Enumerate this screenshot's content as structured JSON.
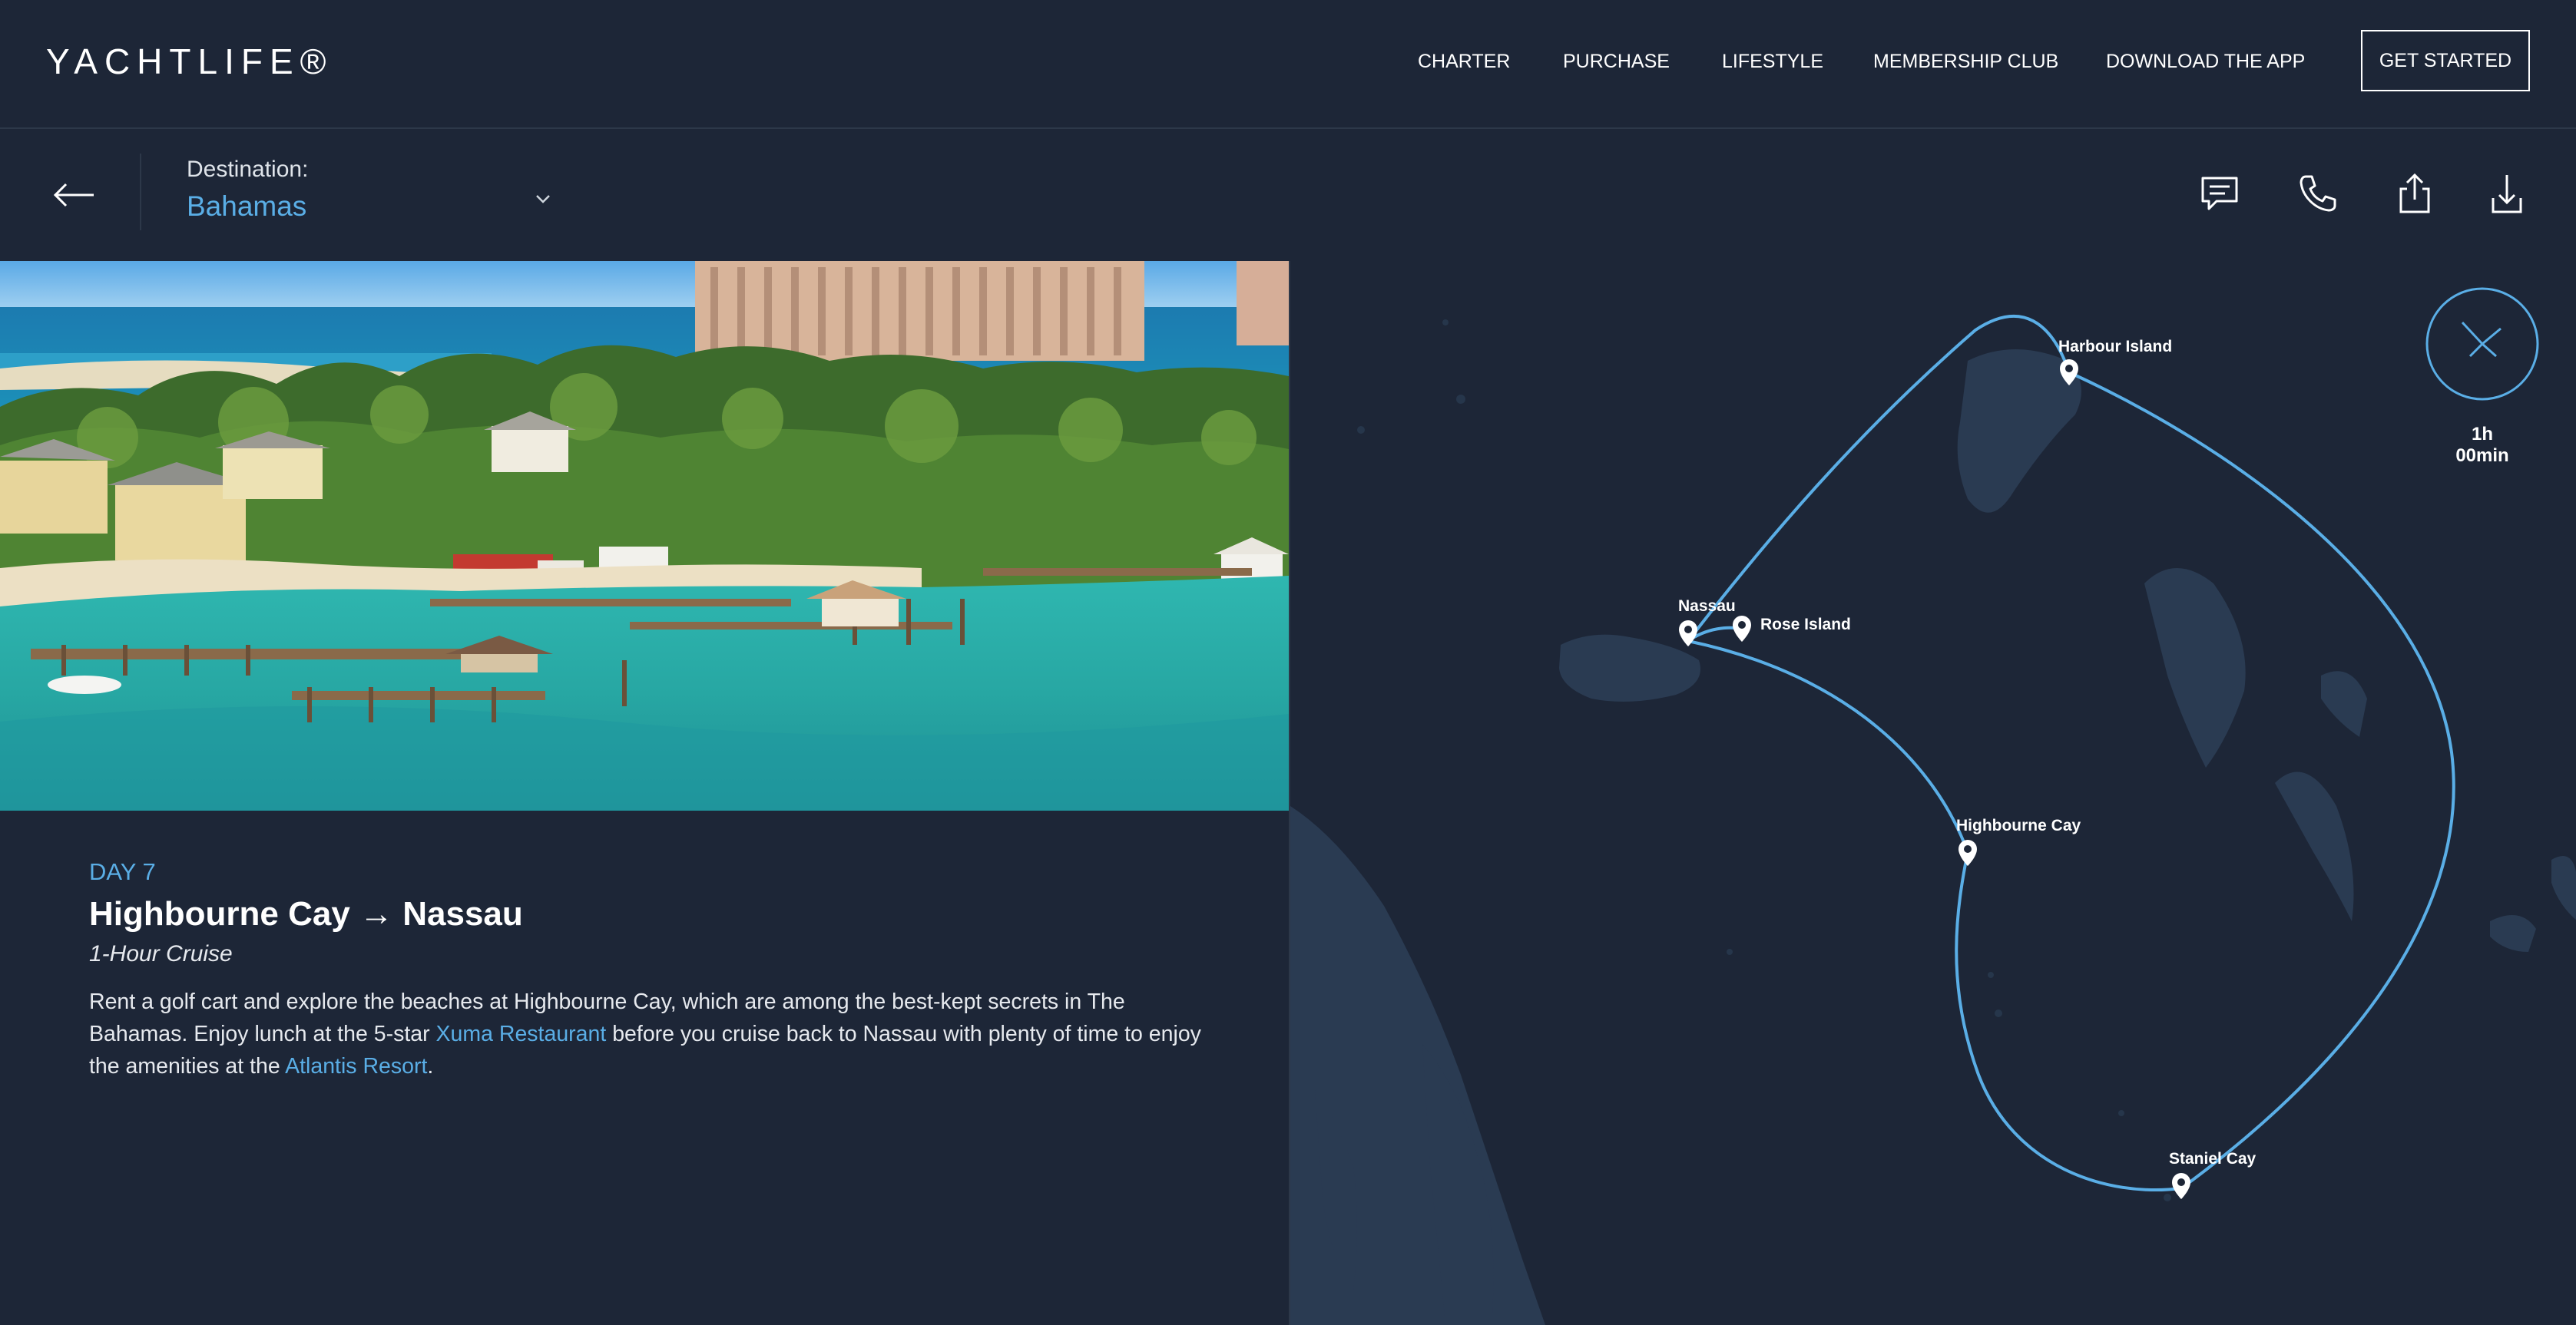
{
  "brand": {
    "logo": "YACHTLIFE®"
  },
  "nav": {
    "links": [
      "CHARTER",
      "PURCHASE",
      "LIFESTYLE",
      "MEMBERSHIP CLUB",
      "DOWNLOAD THE APP"
    ],
    "cta": "GET STARTED"
  },
  "destination": {
    "label": "Destination:",
    "value": "Bahamas",
    "icons": [
      "back-arrow-icon",
      "chevron-down-icon",
      "chat-icon",
      "phone-icon",
      "share-icon",
      "download-icon"
    ]
  },
  "itinerary": {
    "day": "DAY 7",
    "title": "Highbourne Cay → Nassau",
    "subtitle": "1-Hour Cruise",
    "desc_part1": "Rent a golf cart and explore the beaches at Highbourne Cay, which are among the best-kept secrets in The Bahamas. Enjoy lunch at the 5-star ",
    "link1": "Xuma Restaurant",
    "desc_part2": " before you cruise back to Nassau with plenty of time to enjoy the amenities at the ",
    "link2": "Atlantis Resort",
    "desc_part3": "."
  },
  "map": {
    "locations": [
      "Harbour Island",
      "Nassau",
      "Rose Island",
      "Highbourne Cay",
      "Staniel Cay"
    ],
    "route_color": "#5aaee6",
    "timer": "1h 00min"
  },
  "colors": {
    "background": "#1d2637",
    "accent": "#5aaee6",
    "land": "#2a3b52"
  }
}
